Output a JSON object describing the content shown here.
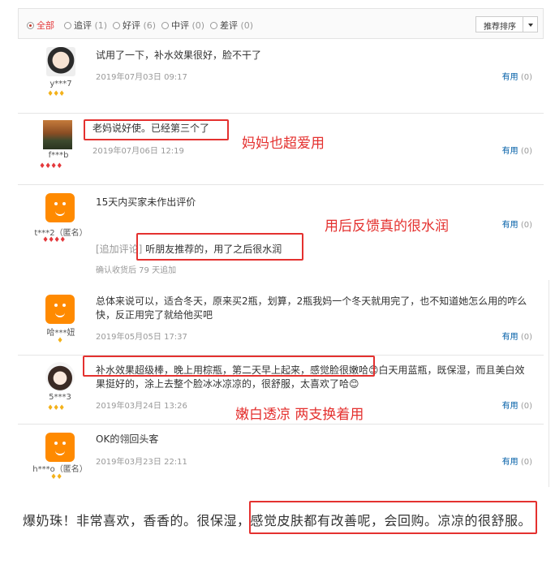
{
  "filters": [
    {
      "label": "全部",
      "count": "",
      "selected": true
    },
    {
      "label": "追评",
      "count": "(1)",
      "selected": false
    },
    {
      "label": "好评",
      "count": "(6)",
      "selected": false
    },
    {
      "label": "中评",
      "count": "(0)",
      "selected": false
    },
    {
      "label": "差评",
      "count": "(0)",
      "selected": false
    }
  ],
  "sort": {
    "label": "推荐排序"
  },
  "useful_label": "有用",
  "reviews": [
    {
      "user": "y***7",
      "level": "♦♦♦",
      "content": "试用了一下，补水效果很好，脸不干了",
      "date": "2019年07月03日 09:17",
      "useful_count": "(0)"
    },
    {
      "user": "f***b",
      "level": "♦♦♦♦",
      "content": "老妈说好使。已经第三个了",
      "date": "2019年07月06日 12:19",
      "useful_count": "(0)"
    },
    {
      "user": "t***2（匿名）",
      "level": "♦♦♦♦",
      "content": "15天内买家未作出评价",
      "append_tag": "[追加评论]",
      "append_text": "听朋友推荐的，用了之后很水润",
      "append_note": "确认收货后 79 天追加",
      "useful_count": "(0)"
    },
    {
      "user": "哈***妞",
      "level": "♦",
      "content": "总体来说可以，适合冬天，原来买2瓶，划算，2瓶我妈一个冬天就用完了，也不知道她怎么用的咋么快，反正用完了就给他买吧",
      "date": "2019年05月05日 17:37",
      "useful_count": "(0)"
    },
    {
      "user": "5***3",
      "level": "♦♦♦",
      "content": "补水效果超级棒，晚上用棕瓶，第二天早上起来，感觉脸很嫩哈😊白天用蓝瓶，既保湿，而且美白效果挺好的，涂上去整个脸冰冰凉凉的，很舒服，太喜欢了哈😊",
      "date": "2019年03月24日 13:26",
      "useful_count": "(0)"
    },
    {
      "user": "h***o（匿名）",
      "level": "♦♦",
      "content": "OK的翎回头客",
      "date": "2019年03月23日 22:11",
      "useful_count": "(0)"
    }
  ],
  "annotations": {
    "mom_loves": "妈妈也超爱用",
    "feedback": "用后反馈真的很水润",
    "whitening": "嫩白透凉  两支换着用"
  },
  "bottom_text": "爆奶珠！非常喜欢，香香的。很保湿，感觉皮肤都有改善呢，会回购。凉凉的很舒服。",
  "colors": {
    "accent": "#e4393c",
    "annotation": "#e4312f",
    "link": "#005ea7",
    "level": "#f3b11a"
  }
}
